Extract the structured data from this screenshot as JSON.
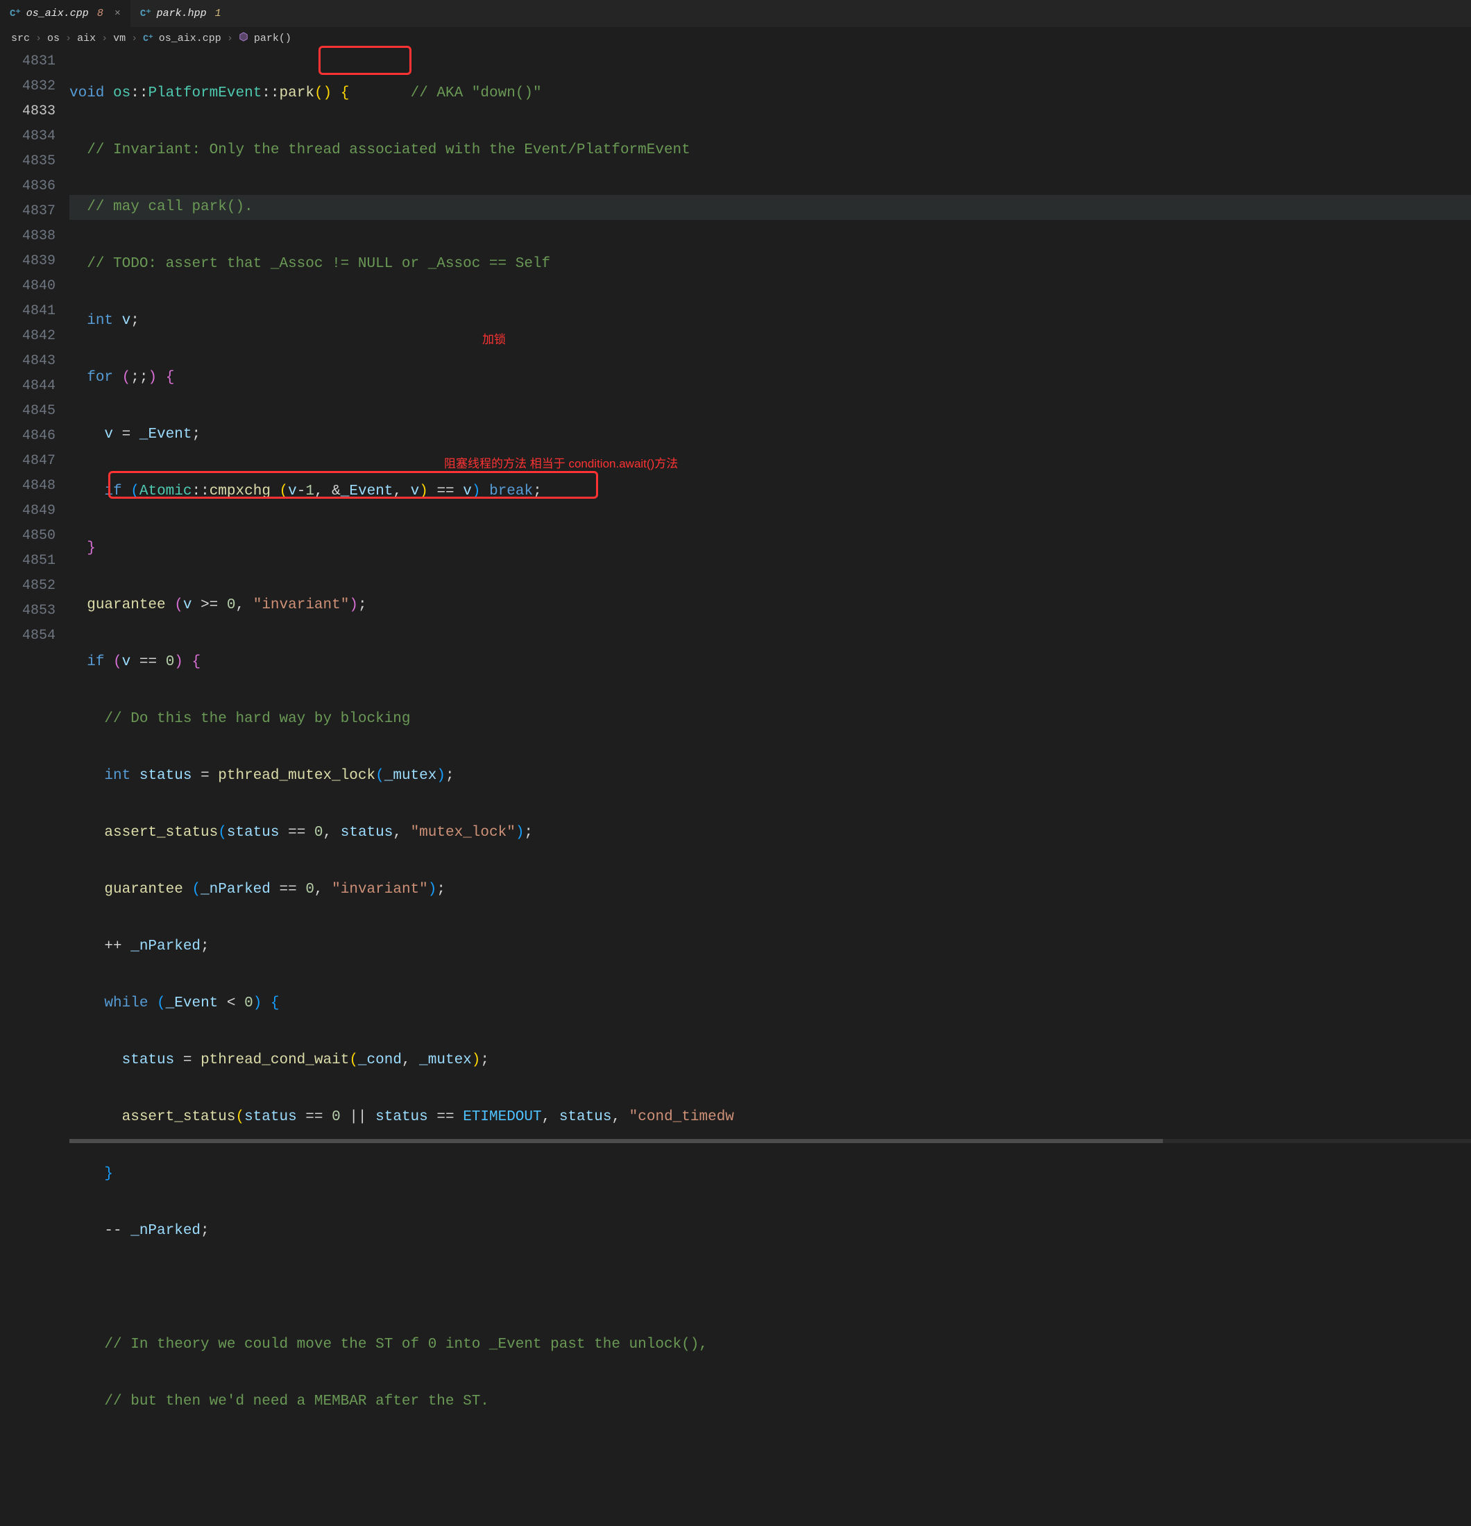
{
  "tabs": [
    {
      "icon": "C⁺",
      "label": "os_aix.cpp",
      "badge": "8",
      "active": true,
      "close": "×"
    },
    {
      "icon": "C⁺",
      "label": "park.hpp",
      "badge": "1",
      "active": false,
      "close": ""
    }
  ],
  "breadcrumbs": {
    "items": [
      "src",
      "os",
      "aix",
      "vm",
      "os_aix.cpp",
      "park()"
    ],
    "sep": "›"
  },
  "line_numbers": [
    "4831",
    "4832",
    "4833",
    "4834",
    "4835",
    "4836",
    "4837",
    "4838",
    "4839",
    "4840",
    "4841",
    "4842",
    "4843",
    "4844",
    "4845",
    "4846",
    "4847",
    "4848",
    "4849",
    "4850",
    "4851",
    "4852",
    "4853",
    "4854"
  ],
  "active_line": 2,
  "code": {
    "l0": {
      "p0": "void",
      "p1": " ",
      "p2": "os",
      "p3": "::",
      "p4": "PlatformEvent",
      "p5": "::",
      "p6": "park",
      "p7": "()",
      "p8": " ",
      "p9": "{",
      "p10": "       ",
      "p11": "// AKA \"down()\""
    },
    "l1": {
      "p0": "  ",
      "p1": "// Invariant: Only the thread associated with the Event/PlatformEvent"
    },
    "l2": {
      "p0": "  ",
      "p1": "// may call park()."
    },
    "l3": {
      "p0": "  ",
      "p1": "// TODO: assert that _Assoc != NULL or _Assoc == Self"
    },
    "l4": {
      "p0": "  ",
      "p1": "int",
      "p2": " ",
      "p3": "v",
      "p4": ";"
    },
    "l5": {
      "p0": "  ",
      "p1": "for",
      "p2": " ",
      "p3": "(",
      "p4": ";;",
      "p5": ")",
      "p6": " ",
      "p7": "{"
    },
    "l6": {
      "p0": "    ",
      "p1": "v",
      "p2": " = ",
      "p3": "_Event",
      "p4": ";"
    },
    "l7": {
      "p0": "    ",
      "p1": "if",
      "p2": " ",
      "p3": "(",
      "p4": "Atomic",
      "p5": "::",
      "p6": "cmpxchg",
      "p7": " ",
      "p8": "(",
      "p9": "v",
      "p10": "-",
      "p11": "1",
      "p12": ", &",
      "p13": "_Event",
      "p14": ", ",
      "p15": "v",
      "p16": ")",
      "p17": " == ",
      "p18": "v",
      "p19": ")",
      "p20": " ",
      "p21": "break",
      "p22": ";"
    },
    "l8": {
      "p0": "  ",
      "p1": "}"
    },
    "l9": {
      "p0": "  ",
      "p1": "guarantee",
      "p2": " ",
      "p3": "(",
      "p4": "v",
      "p5": " >= ",
      "p6": "0",
      "p7": ", ",
      "p8": "\"invariant\"",
      "p9": ")",
      "p10": ";"
    },
    "l10": {
      "p0": "  ",
      "p1": "if",
      "p2": " ",
      "p3": "(",
      "p4": "v",
      "p5": " == ",
      "p6": "0",
      "p7": ")",
      "p8": " ",
      "p9": "{"
    },
    "l11": {
      "p0": "    ",
      "p1": "// Do this the hard way by blocking"
    },
    "l12": {
      "p0": "    ",
      "p1": "int",
      "p2": " ",
      "p3": "status",
      "p4": " = ",
      "p5": "pthread_mutex_lock",
      "p6": "(",
      "p7": "_mutex",
      "p8": ")",
      "p9": ";"
    },
    "l13": {
      "p0": "    ",
      "p1": "assert_status",
      "p2": "(",
      "p3": "status",
      "p4": " == ",
      "p5": "0",
      "p6": ", ",
      "p7": "status",
      "p8": ", ",
      "p9": "\"mutex_lock\"",
      "p10": ")",
      "p11": ";"
    },
    "l14": {
      "p0": "    ",
      "p1": "guarantee",
      "p2": " ",
      "p3": "(",
      "p4": "_nParked",
      "p5": " == ",
      "p6": "0",
      "p7": ", ",
      "p8": "\"invariant\"",
      "p9": ")",
      "p10": ";"
    },
    "l15": {
      "p0": "    ++ ",
      "p1": "_nParked",
      "p2": ";"
    },
    "l16": {
      "p0": "    ",
      "p1": "while",
      "p2": " ",
      "p3": "(",
      "p4": "_Event",
      "p5": " < ",
      "p6": "0",
      "p7": ")",
      "p8": " ",
      "p9": "{"
    },
    "l17": {
      "p0": "      ",
      "p1": "status",
      "p2": " = ",
      "p3": "pthread_cond_wait",
      "p4": "(",
      "p5": "_cond",
      "p6": ", ",
      "p7": "_mutex",
      "p8": ")",
      "p9": ";"
    },
    "l18": {
      "p0": "      ",
      "p1": "assert_status",
      "p2": "(",
      "p3": "status",
      "p4": " == ",
      "p5": "0",
      "p6": " || ",
      "p7": "status",
      "p8": " == ",
      "p9": "ETIMEDOUT",
      "p10": ", ",
      "p11": "status",
      "p12": ", ",
      "p13": "\"cond_timedw"
    },
    "l19": {
      "p0": "    ",
      "p1": "}"
    },
    "l20": {
      "p0": "    -- ",
      "p1": "_nParked",
      "p2": ";"
    },
    "l21": {
      "p0": ""
    },
    "l22": {
      "p0": "    ",
      "p1": "// In theory we could move the ST of 0 into _Event past the unlock(),"
    },
    "l23": {
      "p0": "    ",
      "p1": "// but then we'd need a MEMBAR after the ST."
    }
  },
  "annotations": {
    "a1": "加锁",
    "a2": "阻塞线程的方法 相当于 condition.await()方法"
  }
}
